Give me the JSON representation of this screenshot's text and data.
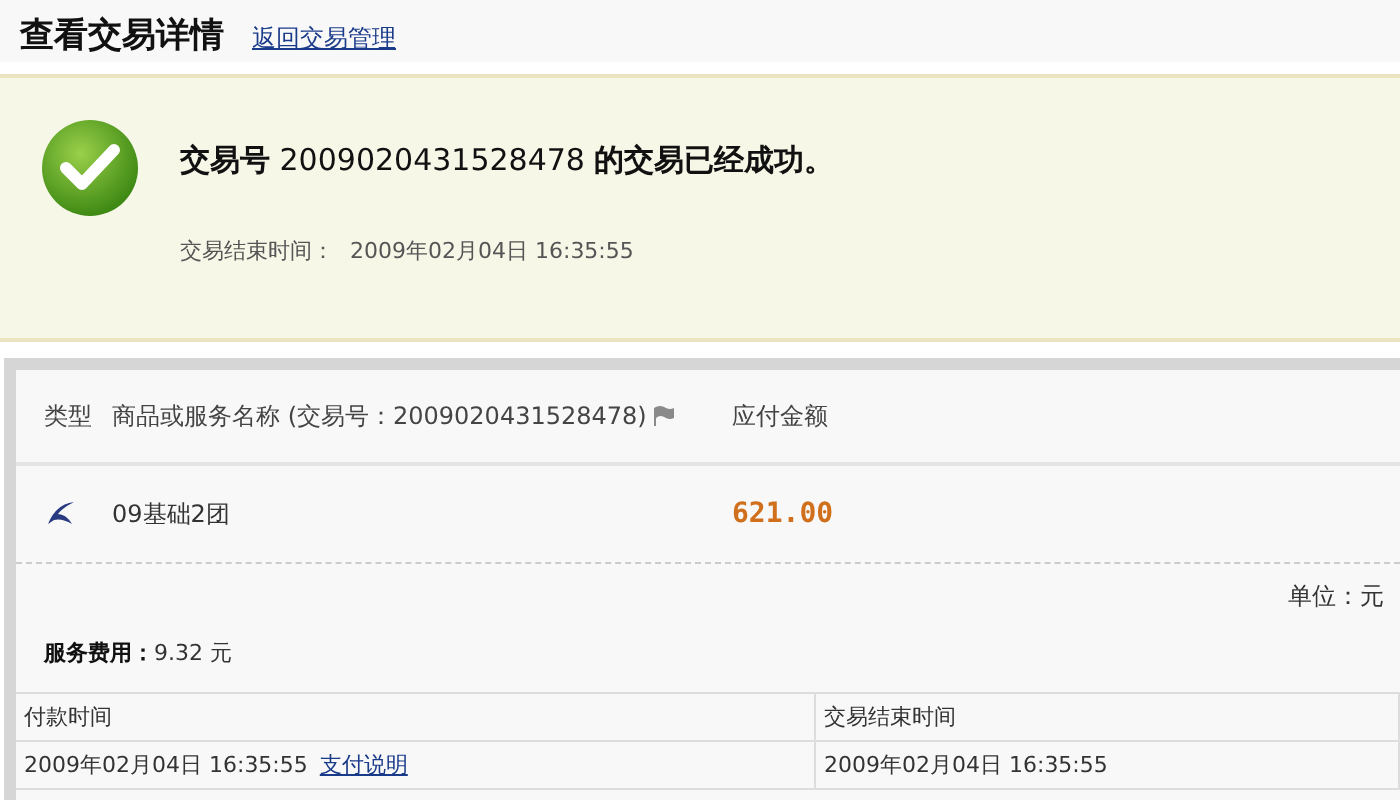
{
  "page_title": "查看交易详情",
  "back_link": "返回交易管理",
  "success": {
    "message": "**交易号** 2009020431528478 **的交易已经成功。**",
    "end_time_label": "交易结束时间：",
    "end_time": "2009年02月04日 16:35:55"
  },
  "items_table": {
    "columns": [
      "类型",
      "商品或服务名称 (交易号：2009020431528478)",
      "应付金额"
    ],
    "rows": [
      {
        "name": "09基础2团",
        "amount": "621.00"
      }
    ]
  },
  "unit": "单位：元",
  "fee": {
    "label": "服务费用：",
    "value": "9.32 元"
  },
  "time_table": {
    "columns": [
      "付款时间",
      "交易结束时间"
    ],
    "payment_time": "2009年02月04日 16:35:55",
    "payment_link": "支付说明",
    "end_time": "2009年02月04日 16:35:55"
  }
}
